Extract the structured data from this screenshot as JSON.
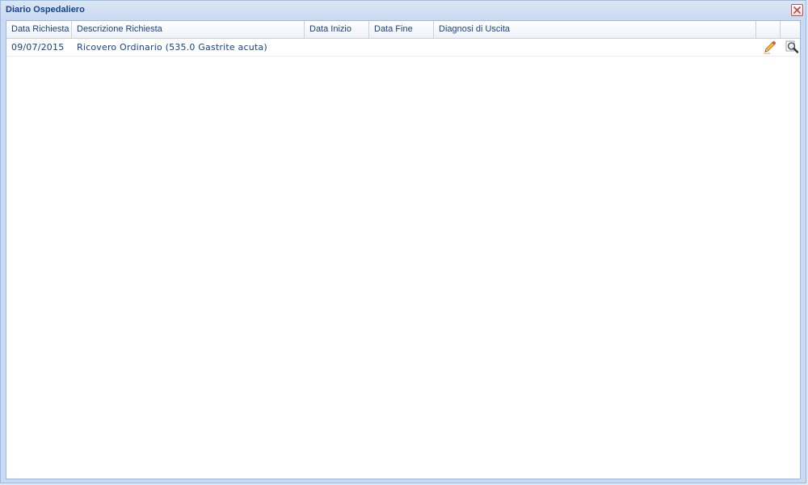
{
  "window": {
    "title": "Diario Ospedaliero",
    "close_icon": "close-icon",
    "colors": {
      "title_text": "#15428b",
      "frame": "#cbdaf0",
      "border": "#99bbe8",
      "close_red": "#c0504d"
    }
  },
  "grid": {
    "columns": [
      {
        "key": "data_richiesta",
        "label": "Data Richiesta"
      },
      {
        "key": "descrizione_richiesta",
        "label": "Descrizione Richiesta"
      },
      {
        "key": "data_inizio",
        "label": "Data Inizio"
      },
      {
        "key": "data_fine",
        "label": "Data Fine"
      },
      {
        "key": "diagnosi_uscita",
        "label": "Diagnosi di Uscita"
      },
      {
        "key": "edit",
        "label": ""
      },
      {
        "key": "view",
        "label": ""
      }
    ],
    "rows": [
      {
        "data_richiesta": "09/07/2015",
        "descrizione_richiesta": "Ricovero Ordinario (535.0 Gastrite acuta)",
        "data_inizio": "",
        "data_fine": "",
        "diagnosi_uscita": "",
        "edit_icon": "pencil-icon",
        "view_icon": "magnifier-icon"
      }
    ]
  }
}
